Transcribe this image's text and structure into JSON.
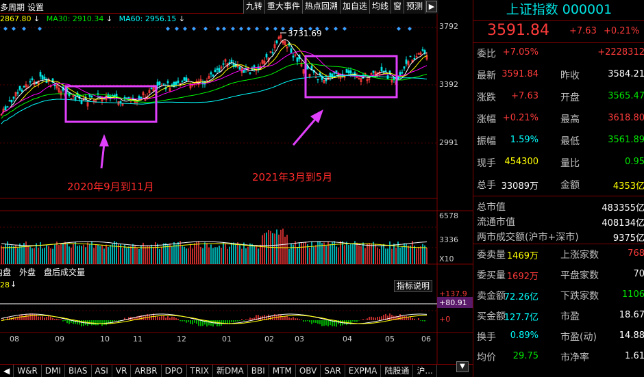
{
  "toolbar": {
    "period_label": "多周期",
    "settings_label": "设置",
    "buttons": [
      "九转",
      "重大事件",
      "热点回溯",
      "加自选",
      "均线",
      "窗",
      "预测"
    ],
    "collapse_icon": "collapse-right-icon"
  },
  "ma_line": {
    "ma10": "2867.80",
    "ma30_label": "MA30: 2910.34",
    "ma60_label": "MA60: 2956.15"
  },
  "chart": {
    "price_axis": [
      "3792",
      "3392",
      "2991"
    ],
    "peak_label": "3731.69",
    "volume_axis": [
      "6578",
      "3336",
      "X10"
    ],
    "macd_axis": [
      "+137.9",
      "+80.91",
      "+0"
    ],
    "macd_value_left": "28",
    "months": [
      "08",
      "09",
      "10",
      "11",
      "12",
      "01",
      "02",
      "03",
      "04",
      "05",
      "06"
    ],
    "annotation_1": "2020年9月到11月",
    "annotation_2": "2021年3月到5月",
    "colors": {
      "up": "#ff3b3b",
      "down": "#00e6e6",
      "box": "#e040fb",
      "arrow": "#e040fb"
    }
  },
  "volume_tabs": [
    "内盘",
    "外盘",
    "盘后成交量"
  ],
  "indicator_button": "指标说明",
  "bottom_tabs": [
    "W&R",
    "DMI",
    "BIAS",
    "ASI",
    "VR",
    "ARBR",
    "DPO",
    "TRIX",
    "新DMA",
    "BBI",
    "MTM",
    "OBV",
    "SAR",
    "EXPMA",
    "陆股通",
    "沪..."
  ],
  "panel": {
    "title": "上证指数 000001",
    "price": "3591.84",
    "change": "+7.63",
    "change_pct": "+0.21%",
    "rows": [
      {
        "k": "委比",
        "v": "+7.05%",
        "vc": "red",
        "k2": "",
        "v2": "+2228312",
        "v2c": "red"
      },
      {
        "k": "最新",
        "v": "3591.84",
        "vc": "red",
        "k2": "昨收",
        "v2": "3584.21",
        "v2c": "white"
      },
      {
        "k": "涨跌",
        "v": "+7.63",
        "vc": "red",
        "k2": "开盘",
        "v2": "3565.47",
        "v2c": "green"
      },
      {
        "k": "涨幅",
        "v": "+0.21%",
        "vc": "red",
        "k2": "最高",
        "v2": "3618.80",
        "v2c": "red"
      },
      {
        "k": "振幅",
        "v": "1.59%",
        "vc": "cyan",
        "k2": "最低",
        "v2": "3561.89",
        "v2c": "green"
      },
      {
        "k": "现手",
        "v": "454300",
        "vc": "yellow",
        "k2": "量比",
        "v2": "0.95",
        "v2c": "green"
      },
      {
        "k": "总手",
        "v": "33089万",
        "vc": "white",
        "k2": "金额",
        "v2": "4353亿",
        "v2c": "yellow"
      }
    ],
    "rows_full": [
      {
        "k": "总市值",
        "v": "483355亿"
      },
      {
        "k": "流通市值",
        "v": "408134亿"
      },
      {
        "k": "两市成交额(沪市+深市)",
        "v": "9375亿"
      }
    ],
    "rows_b": [
      {
        "k": "委卖量",
        "v": "1469万",
        "vc": "yellow",
        "k2": "上涨家数",
        "v2": "768",
        "v2c": "red"
      },
      {
        "k": "委买量",
        "v": "1692万",
        "vc": "red",
        "k2": "平盘家数",
        "v2": "70",
        "v2c": "white"
      },
      {
        "k": "卖金额",
        "v": "72.26亿",
        "vc": "cyan",
        "k2": "下跌家数",
        "v2": "1106",
        "v2c": "green"
      },
      {
        "k": "买金额",
        "v": "127.7亿",
        "vc": "cyan",
        "k2": "市盈",
        "v2": "18.67",
        "v2c": "white"
      },
      {
        "k": "换手",
        "v": "0.89%",
        "vc": "cyan",
        "k2": "市盈(动)",
        "v2": "14.88",
        "v2c": "white"
      },
      {
        "k": "均价",
        "v": "29.75",
        "vc": "green",
        "k2": "市净率",
        "v2": "1.61",
        "v2c": "white"
      }
    ]
  }
}
